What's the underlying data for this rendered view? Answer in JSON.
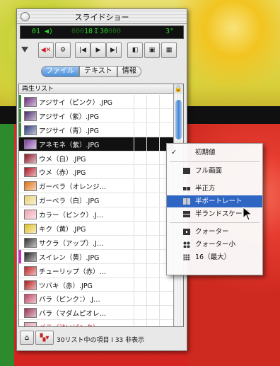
{
  "window": {
    "title": "スライドショー"
  },
  "lcd": {
    "index": "01",
    "counter_left": "000",
    "counter_a": "18",
    "separator": "I",
    "counter_b": "30",
    "counter_right": "000",
    "duration": "3\""
  },
  "tabs": [
    {
      "label": "ファイル",
      "active": true
    },
    {
      "label": "テキスト",
      "active": false
    },
    {
      "label": "情報",
      "active": false
    }
  ],
  "playlist": {
    "header": "再生リスト",
    "rows": [
      {
        "name": "アジサイ（ピンク）.JPG",
        "mark": "#2e8b2e",
        "thumb": "#6b2a7a",
        "style": "normal"
      },
      {
        "name": "アジサイ（紫）.JPG",
        "mark": "#2e8b2e",
        "thumb": "#4b2a6a",
        "style": "normal"
      },
      {
        "name": "アジサイ（青）.JPG",
        "mark": "#2e8b2e",
        "thumb": "#2a3a7a",
        "style": "normal"
      },
      {
        "name": "アネモネ（紫）.JPG",
        "mark": "#111111",
        "thumb": "#7a3aa0",
        "style": "selected"
      },
      {
        "name": "ウメ（白）.JPG",
        "mark": "",
        "thumb": "#8a1020",
        "style": "normal"
      },
      {
        "name": "ウメ（赤）.JPG",
        "mark": "",
        "thumb": "#b01020",
        "style": "normal"
      },
      {
        "name": "ガーベラ（オレンジ…",
        "mark": "",
        "thumb": "#e07010",
        "style": "normal"
      },
      {
        "name": "ガーベラ（白）.JPG",
        "mark": "",
        "thumb": "#e8d070",
        "style": "normal"
      },
      {
        "name": "カラー（ピンク）.J…",
        "mark": "",
        "thumb": "#f0a0b0",
        "style": "normal"
      },
      {
        "name": "キク（黄）.JPG",
        "mark": "",
        "thumb": "#e0c020",
        "style": "normal"
      },
      {
        "name": "サクラ（アップ）.J…",
        "mark": "",
        "thumb": "#303030",
        "style": "normal"
      },
      {
        "name": "スイレン（黄）.JPG",
        "mark": "#e020d0",
        "thumb": "#202020",
        "style": "normal"
      },
      {
        "name": "チューリップ（赤）…",
        "mark": "",
        "thumb": "#c02020",
        "style": "normal"
      },
      {
        "name": "ツバキ（赤）.JPG",
        "mark": "",
        "thumb": "#b01818",
        "style": "normal"
      },
      {
        "name": "バラ（ピンク：）.J…",
        "mark": "",
        "thumb": "#c04060",
        "style": "normal"
      },
      {
        "name": "バラ（マダムピオレ…",
        "mark": "",
        "thumb": "#9a3050",
        "style": "normal"
      },
      {
        "name": "バラ（淡いピンク）…",
        "mark": "",
        "thumb": "#e0a0b0",
        "style": "red"
      }
    ]
  },
  "status": {
    "text": "30リスト中の項目 I 33 非表示"
  },
  "menu": {
    "items": [
      {
        "label": "初期値",
        "checked": true,
        "highlighted": false,
        "icon": ""
      },
      {
        "label": "フル画面",
        "checked": false,
        "highlighted": false,
        "icon": "full"
      },
      {
        "label": "半正方",
        "checked": false,
        "highlighted": false,
        "icon": "half-square"
      },
      {
        "label": "半ポートレート",
        "checked": false,
        "highlighted": true,
        "icon": "half-portrait"
      },
      {
        "label": "半ランドスケープ",
        "checked": false,
        "highlighted": false,
        "icon": "half-landscape"
      },
      {
        "label": "クォーター",
        "checked": false,
        "highlighted": false,
        "icon": "quarter"
      },
      {
        "label": "クォーター小",
        "checked": false,
        "highlighted": false,
        "icon": "quarter-small"
      },
      {
        "label": "16（最大）",
        "checked": false,
        "highlighted": false,
        "icon": "grid16"
      }
    ]
  }
}
